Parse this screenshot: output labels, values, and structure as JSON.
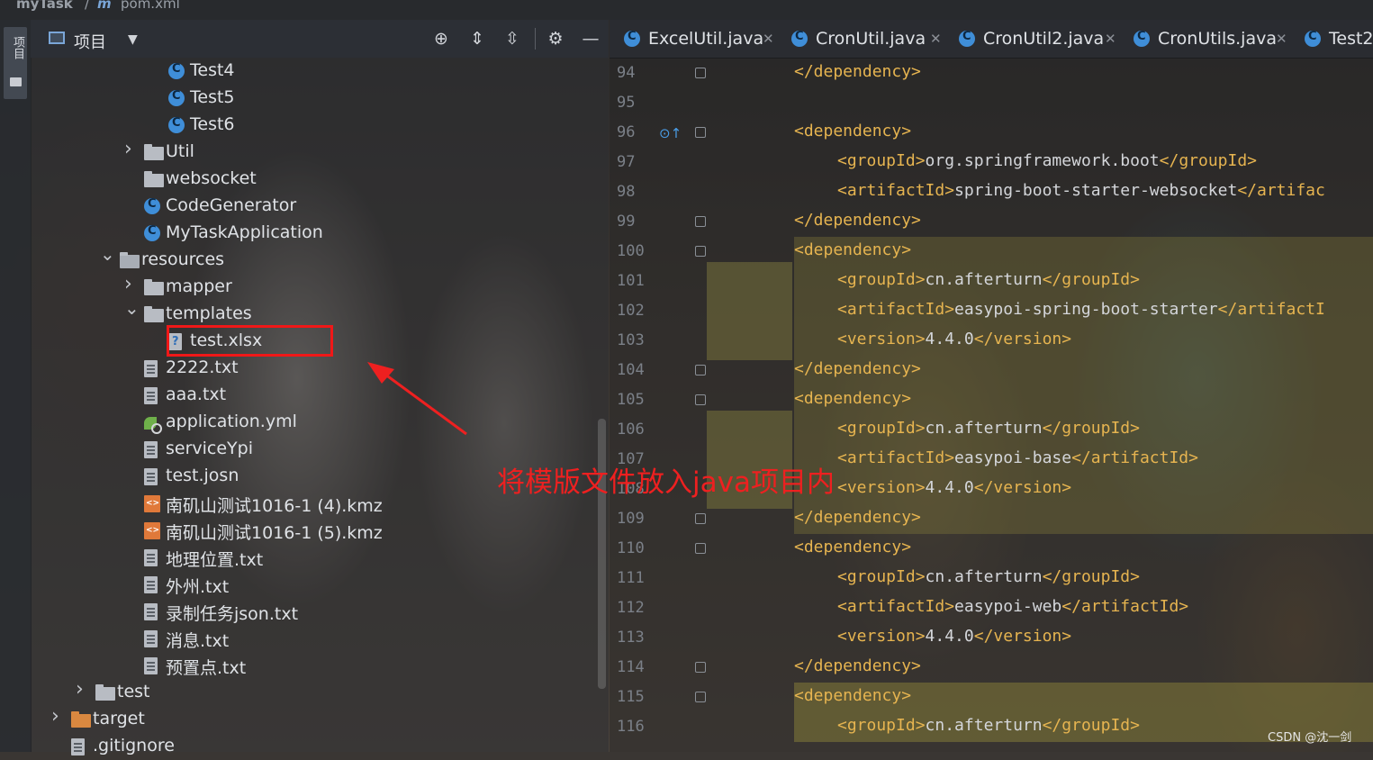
{
  "topbar": {
    "project": "myTask",
    "separator": "/",
    "file": "pom.xml"
  },
  "sidestrip": {
    "tab_label": "项目"
  },
  "project_panel": {
    "title": "项目",
    "tree": [
      {
        "label": "Test4",
        "type": "class",
        "indent": 3
      },
      {
        "label": "Test5",
        "type": "class",
        "indent": 3
      },
      {
        "label": "Test6",
        "type": "class",
        "indent": 3
      },
      {
        "label": "Util",
        "type": "folder",
        "indent": 2,
        "chevron": "›"
      },
      {
        "label": "websocket",
        "type": "folder",
        "indent": 2
      },
      {
        "label": "CodeGenerator",
        "type": "class",
        "indent": 2
      },
      {
        "label": "MyTaskApplication",
        "type": "app",
        "indent": 2
      },
      {
        "label": "resources",
        "type": "res",
        "indent": 1,
        "chevron": "⌄"
      },
      {
        "label": "mapper",
        "type": "folder",
        "indent": 2,
        "chevron": "›"
      },
      {
        "label": "templates",
        "type": "folder",
        "indent": 2,
        "chevron": "⌄"
      },
      {
        "label": "test.xlsx",
        "type": "xlsx",
        "indent": 3
      },
      {
        "label": "2222.txt",
        "type": "file",
        "indent": 2
      },
      {
        "label": "aaa.txt",
        "type": "file",
        "indent": 2
      },
      {
        "label": "application.yml",
        "type": "yml",
        "indent": 2
      },
      {
        "label": "serviceYpi",
        "type": "file",
        "indent": 2
      },
      {
        "label": "test.josn",
        "type": "file",
        "indent": 2
      },
      {
        "label": "南矶山测试1016-1 (4).kmz",
        "type": "kmz",
        "indent": 2
      },
      {
        "label": "南矶山测试1016-1 (5).kmz",
        "type": "kmz",
        "indent": 2
      },
      {
        "label": "地理位置.txt",
        "type": "file",
        "indent": 2
      },
      {
        "label": "外州.txt",
        "type": "file",
        "indent": 2
      },
      {
        "label": "录制任务json.txt",
        "type": "file",
        "indent": 2
      },
      {
        "label": "消息.txt",
        "type": "file",
        "indent": 2
      },
      {
        "label": "预置点.txt",
        "type": "file",
        "indent": 2
      },
      {
        "label": "test",
        "type": "folder",
        "indent": 0,
        "chevron": "›"
      },
      {
        "label": "target",
        "type": "target",
        "indent": -1,
        "chevron": "›"
      },
      {
        "label": ".gitignore",
        "type": "file",
        "indent": -1
      }
    ]
  },
  "editor": {
    "tabs": [
      "ExcelUtil.java",
      "CronUtil.java",
      "CronUtil2.java",
      "CronUtils.java",
      "Test2"
    ],
    "lines": [
      {
        "n": "94",
        "level": 1,
        "code": "</dependency>"
      },
      {
        "n": "95",
        "level": 0,
        "code": ""
      },
      {
        "n": "96",
        "level": 1,
        "code": "<dependency>"
      },
      {
        "n": "97",
        "level": 2,
        "code": "<groupId>org.springframework.boot</groupId>"
      },
      {
        "n": "98",
        "level": 2,
        "code": "<artifactId>spring-boot-starter-websocket</artifac"
      },
      {
        "n": "99",
        "level": 1,
        "code": "</dependency>"
      },
      {
        "n": "100",
        "level": 1,
        "code": "<dependency>"
      },
      {
        "n": "101",
        "level": 2,
        "code": "<groupId>cn.afterturn</groupId>"
      },
      {
        "n": "102",
        "level": 2,
        "code": "<artifactId>easypoi-spring-boot-starter</artifactI"
      },
      {
        "n": "103",
        "level": 2,
        "code": "<version>4.4.0</version>"
      },
      {
        "n": "104",
        "level": 1,
        "code": "</dependency>"
      },
      {
        "n": "105",
        "level": 1,
        "code": "<dependency>"
      },
      {
        "n": "106",
        "level": 2,
        "code": "<groupId>cn.afterturn</groupId>"
      },
      {
        "n": "107",
        "level": 2,
        "code": "<artifactId>easypoi-base</artifactId>"
      },
      {
        "n": "108",
        "level": 2,
        "code": "<version>4.4.0</version>"
      },
      {
        "n": "109",
        "level": 1,
        "code": "</dependency>"
      },
      {
        "n": "110",
        "level": 1,
        "code": "<dependency>"
      },
      {
        "n": "111",
        "level": 2,
        "code": "<groupId>cn.afterturn</groupId>"
      },
      {
        "n": "112",
        "level": 2,
        "code": "<artifactId>easypoi-web</artifactId>"
      },
      {
        "n": "113",
        "level": 2,
        "code": "<version>4.4.0</version>"
      },
      {
        "n": "114",
        "level": 1,
        "code": "</dependency>"
      },
      {
        "n": "115",
        "level": 1,
        "code": "<dependency>"
      },
      {
        "n": "116",
        "level": 2,
        "code": "<groupId>cn.afterturn</groupId>"
      }
    ]
  },
  "annotation": {
    "text": "将模版文件放入java项目内",
    "color": "#ee2020"
  },
  "watermark": "CSDN @沈一剑",
  "colors": {
    "tag": "#e6b450",
    "text": "#d4d6da",
    "highlight": "#f01818"
  },
  "icons": [
    "search-target-icon",
    "expand-all-icon",
    "collapse-all-icon",
    "gear-icon",
    "minimize-icon",
    "chevron-down-icon",
    "close-icon"
  ]
}
